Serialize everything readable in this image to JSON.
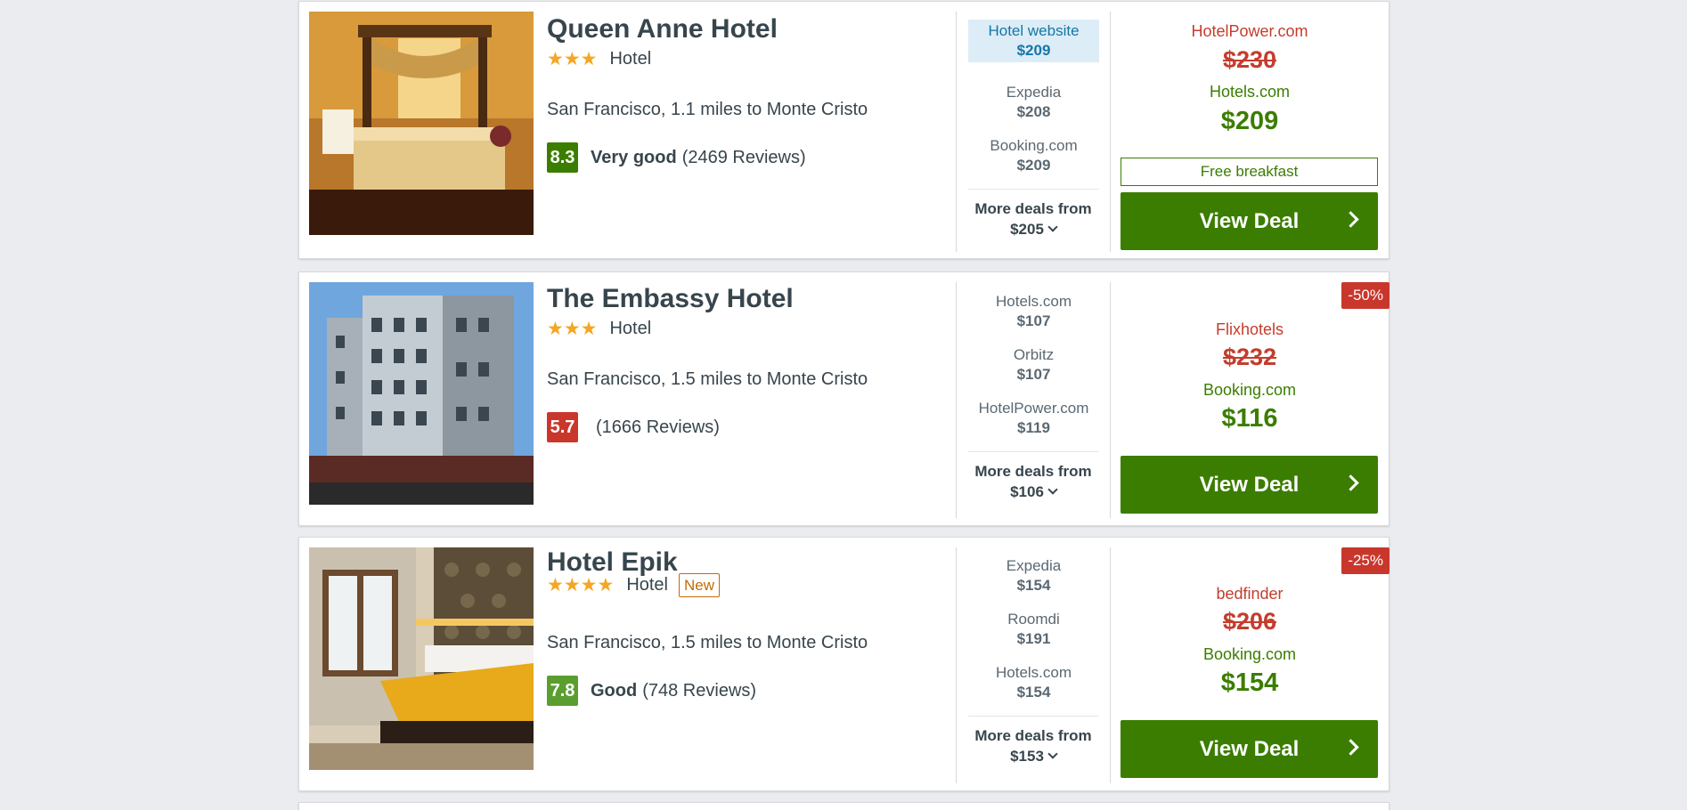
{
  "colors": {
    "background": "#ebecef",
    "view_deal_green": "#3b7d00",
    "strike_red": "#c43d2d",
    "star": "#f5a623"
  },
  "hotels": [
    {
      "name": "Queen Anne Hotel",
      "stars": "★★★",
      "star_count": 3,
      "type": "Hotel",
      "location": "San Francisco, 1.1 miles to Monte Cristo",
      "score": "8.3",
      "score_color": "#3b7d00",
      "rating_word": "Very good",
      "reviews": "(2469 Reviews)",
      "deals": [
        {
          "provider": "Hotel website",
          "price": "$209",
          "highlighted": true
        },
        {
          "provider": "Expedia",
          "price": "$208"
        },
        {
          "provider": "Booking.com",
          "price": "$209"
        }
      ],
      "more_label": "More deals from",
      "more_price": "$205",
      "old_provider": "HotelPower.com",
      "old_price": "$230",
      "new_provider": "Hotels.com",
      "new_price": "$209",
      "perk": "Free breakfast",
      "view_deal": "View Deal"
    },
    {
      "name": "The Embassy Hotel",
      "stars": "★★★",
      "star_count": 3,
      "type": "Hotel",
      "location": "San Francisco, 1.5 miles to Monte Cristo",
      "score": "5.7",
      "score_color": "#c9372c",
      "rating_word": "",
      "reviews": "(1666 Reviews)",
      "discount": "-50%",
      "deals": [
        {
          "provider": "Hotels.com",
          "price": "$107"
        },
        {
          "provider": "Orbitz",
          "price": "$107"
        },
        {
          "provider": "HotelPower.com",
          "price": "$119"
        }
      ],
      "more_label": "More deals from",
      "more_price": "$106",
      "old_provider": "Flixhotels",
      "old_price": "$232",
      "new_provider": "Booking.com",
      "new_price": "$116",
      "view_deal": "View Deal"
    },
    {
      "name": "Hotel Epik",
      "stars": "★★★★",
      "star_count": 4,
      "type": "Hotel",
      "new_badge": "New",
      "location": "San Francisco, 1.5 miles to Monte Cristo",
      "score": "7.8",
      "score_color": "#5a9e2f",
      "rating_word": "Good",
      "reviews": "(748 Reviews)",
      "discount": "-25%",
      "deals": [
        {
          "provider": "Expedia",
          "price": "$154"
        },
        {
          "provider": "Roomdi",
          "price": "$191"
        },
        {
          "provider": "Hotels.com",
          "price": "$154"
        }
      ],
      "more_label": "More deals from",
      "more_price": "$153",
      "old_provider": "bedfinder",
      "old_price": "$206",
      "new_provider": "Booking.com",
      "new_price": "$154",
      "view_deal": "View Deal"
    }
  ]
}
